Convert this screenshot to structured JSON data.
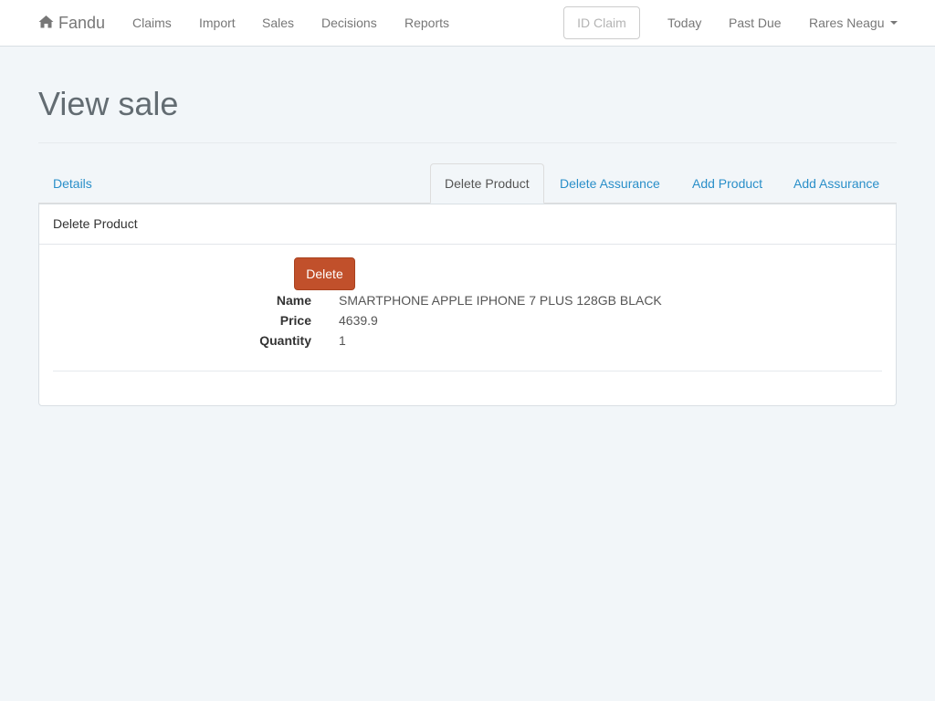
{
  "navbar": {
    "brand": "Fandu",
    "brand_icon": "home-icon",
    "links": [
      "Claims",
      "Import",
      "Sales",
      "Decisions",
      "Reports"
    ],
    "id_claim_placeholder": "ID Claim",
    "right_links": [
      "Today",
      "Past Due"
    ],
    "user": "Rares Neagu"
  },
  "page": {
    "title": "View sale"
  },
  "tabs": {
    "details": "Details",
    "items": [
      "Delete Product",
      "Delete Assurance",
      "Add Product",
      "Add Assurance"
    ],
    "active": "Delete Product"
  },
  "panel": {
    "heading": "Delete Product",
    "delete_label": "Delete",
    "fields": [
      {
        "label": "Name",
        "value": "SMARTPHONE APPLE IPHONE 7 PLUS 128GB BLACK"
      },
      {
        "label": "Price",
        "value": "4639.9"
      },
      {
        "label": "Quantity",
        "value": "1"
      }
    ]
  },
  "colors": {
    "link": "#2a8fc9",
    "danger": "#c1502b",
    "background": "#f2f6f9"
  }
}
